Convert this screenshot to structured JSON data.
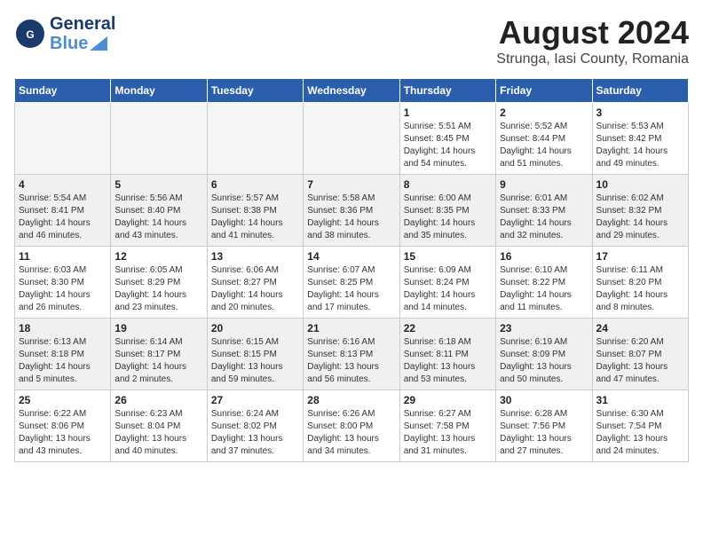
{
  "header": {
    "logo_general": "General",
    "logo_blue": "Blue",
    "month_title": "August 2024",
    "subtitle": "Strunga, Iasi County, Romania"
  },
  "weekdays": [
    "Sunday",
    "Monday",
    "Tuesday",
    "Wednesday",
    "Thursday",
    "Friday",
    "Saturday"
  ],
  "weeks": [
    [
      {
        "num": "",
        "empty": true
      },
      {
        "num": "",
        "empty": true
      },
      {
        "num": "",
        "empty": true
      },
      {
        "num": "",
        "empty": true
      },
      {
        "num": "1",
        "info": "Sunrise: 5:51 AM\nSunset: 8:45 PM\nDaylight: 14 hours\nand 54 minutes."
      },
      {
        "num": "2",
        "info": "Sunrise: 5:52 AM\nSunset: 8:44 PM\nDaylight: 14 hours\nand 51 minutes."
      },
      {
        "num": "3",
        "info": "Sunrise: 5:53 AM\nSunset: 8:42 PM\nDaylight: 14 hours\nand 49 minutes."
      }
    ],
    [
      {
        "num": "4",
        "info": "Sunrise: 5:54 AM\nSunset: 8:41 PM\nDaylight: 14 hours\nand 46 minutes."
      },
      {
        "num": "5",
        "info": "Sunrise: 5:56 AM\nSunset: 8:40 PM\nDaylight: 14 hours\nand 43 minutes."
      },
      {
        "num": "6",
        "info": "Sunrise: 5:57 AM\nSunset: 8:38 PM\nDaylight: 14 hours\nand 41 minutes."
      },
      {
        "num": "7",
        "info": "Sunrise: 5:58 AM\nSunset: 8:36 PM\nDaylight: 14 hours\nand 38 minutes."
      },
      {
        "num": "8",
        "info": "Sunrise: 6:00 AM\nSunset: 8:35 PM\nDaylight: 14 hours\nand 35 minutes."
      },
      {
        "num": "9",
        "info": "Sunrise: 6:01 AM\nSunset: 8:33 PM\nDaylight: 14 hours\nand 32 minutes."
      },
      {
        "num": "10",
        "info": "Sunrise: 6:02 AM\nSunset: 8:32 PM\nDaylight: 14 hours\nand 29 minutes."
      }
    ],
    [
      {
        "num": "11",
        "info": "Sunrise: 6:03 AM\nSunset: 8:30 PM\nDaylight: 14 hours\nand 26 minutes."
      },
      {
        "num": "12",
        "info": "Sunrise: 6:05 AM\nSunset: 8:29 PM\nDaylight: 14 hours\nand 23 minutes."
      },
      {
        "num": "13",
        "info": "Sunrise: 6:06 AM\nSunset: 8:27 PM\nDaylight: 14 hours\nand 20 minutes."
      },
      {
        "num": "14",
        "info": "Sunrise: 6:07 AM\nSunset: 8:25 PM\nDaylight: 14 hours\nand 17 minutes."
      },
      {
        "num": "15",
        "info": "Sunrise: 6:09 AM\nSunset: 8:24 PM\nDaylight: 14 hours\nand 14 minutes."
      },
      {
        "num": "16",
        "info": "Sunrise: 6:10 AM\nSunset: 8:22 PM\nDaylight: 14 hours\nand 11 minutes."
      },
      {
        "num": "17",
        "info": "Sunrise: 6:11 AM\nSunset: 8:20 PM\nDaylight: 14 hours\nand 8 minutes."
      }
    ],
    [
      {
        "num": "18",
        "info": "Sunrise: 6:13 AM\nSunset: 8:18 PM\nDaylight: 14 hours\nand 5 minutes."
      },
      {
        "num": "19",
        "info": "Sunrise: 6:14 AM\nSunset: 8:17 PM\nDaylight: 14 hours\nand 2 minutes."
      },
      {
        "num": "20",
        "info": "Sunrise: 6:15 AM\nSunset: 8:15 PM\nDaylight: 13 hours\nand 59 minutes."
      },
      {
        "num": "21",
        "info": "Sunrise: 6:16 AM\nSunset: 8:13 PM\nDaylight: 13 hours\nand 56 minutes."
      },
      {
        "num": "22",
        "info": "Sunrise: 6:18 AM\nSunset: 8:11 PM\nDaylight: 13 hours\nand 53 minutes."
      },
      {
        "num": "23",
        "info": "Sunrise: 6:19 AM\nSunset: 8:09 PM\nDaylight: 13 hours\nand 50 minutes."
      },
      {
        "num": "24",
        "info": "Sunrise: 6:20 AM\nSunset: 8:07 PM\nDaylight: 13 hours\nand 47 minutes."
      }
    ],
    [
      {
        "num": "25",
        "info": "Sunrise: 6:22 AM\nSunset: 8:06 PM\nDaylight: 13 hours\nand 43 minutes."
      },
      {
        "num": "26",
        "info": "Sunrise: 6:23 AM\nSunset: 8:04 PM\nDaylight: 13 hours\nand 40 minutes."
      },
      {
        "num": "27",
        "info": "Sunrise: 6:24 AM\nSunset: 8:02 PM\nDaylight: 13 hours\nand 37 minutes."
      },
      {
        "num": "28",
        "info": "Sunrise: 6:26 AM\nSunset: 8:00 PM\nDaylight: 13 hours\nand 34 minutes."
      },
      {
        "num": "29",
        "info": "Sunrise: 6:27 AM\nSunset: 7:58 PM\nDaylight: 13 hours\nand 31 minutes."
      },
      {
        "num": "30",
        "info": "Sunrise: 6:28 AM\nSunset: 7:56 PM\nDaylight: 13 hours\nand 27 minutes."
      },
      {
        "num": "31",
        "info": "Sunrise: 6:30 AM\nSunset: 7:54 PM\nDaylight: 13 hours\nand 24 minutes."
      }
    ]
  ]
}
